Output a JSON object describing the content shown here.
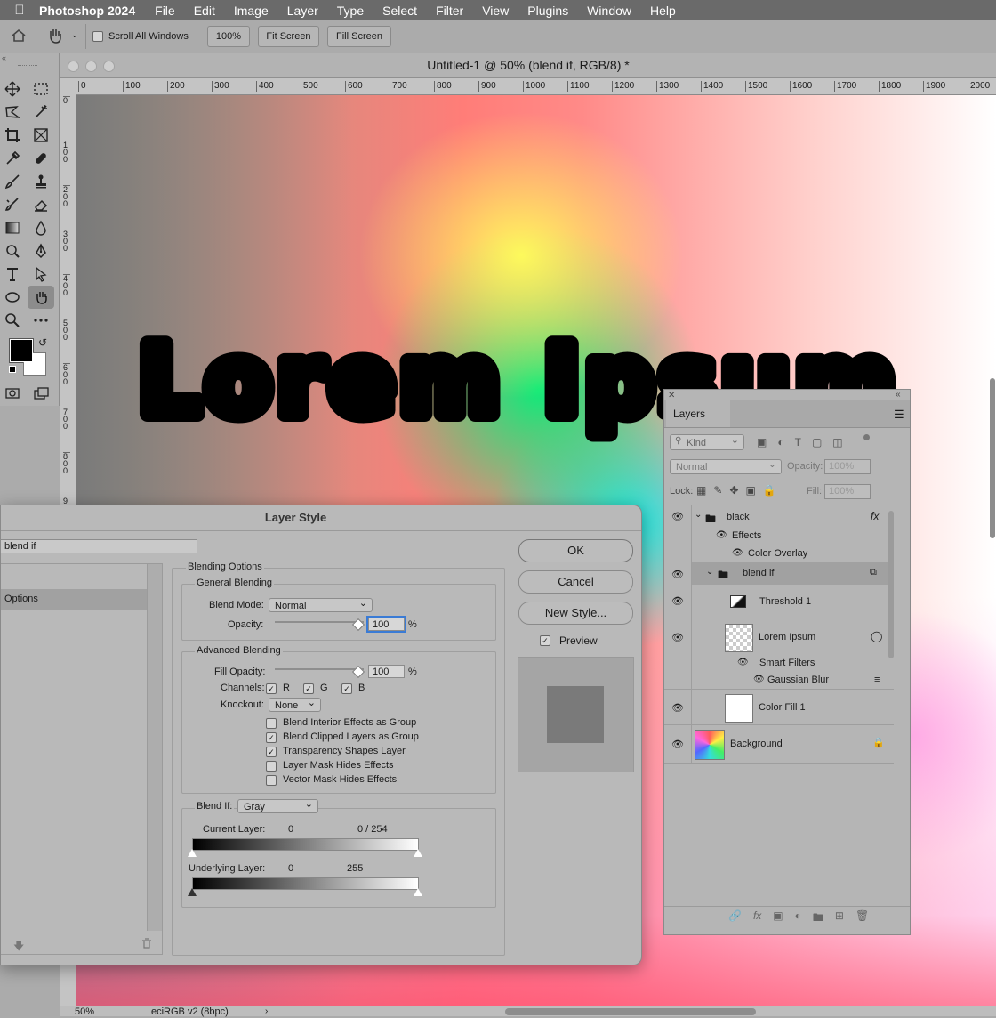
{
  "menubar": {
    "app": "Photoshop 2024",
    "items": [
      "File",
      "Edit",
      "Image",
      "Layer",
      "Type",
      "Select",
      "Filter",
      "View",
      "Plugins",
      "Window",
      "Help"
    ]
  },
  "optionsbar": {
    "scroll_all": "Scroll All Windows",
    "zoom_btn": "100%",
    "fit_btn": "Fit Screen",
    "fill_btn": "Fill Screen"
  },
  "document": {
    "title": "Untitled-1 @ 50% (blend if, RGB/8) *",
    "canvas_text": "Lorem Ipsum",
    "ruler_h": [
      "0",
      "100",
      "200",
      "300",
      "400",
      "500",
      "600",
      "700",
      "800",
      "900",
      "1000",
      "1100",
      "1200",
      "1300",
      "1400",
      "1500",
      "1600",
      "1700",
      "1800",
      "1900",
      "2000"
    ],
    "ruler_v": [
      "0",
      "100",
      "200",
      "300",
      "400",
      "500",
      "600",
      "700",
      "800",
      "900"
    ]
  },
  "statusbar": {
    "zoom": "50%",
    "profile": "eciRGB v2 (8bpc)"
  },
  "dialog": {
    "title": "Layer Style",
    "style_name": "blend if",
    "left_item": "Options",
    "blending_options": "Blending Options",
    "general_blending": "General Blending",
    "blend_mode_label": "Blend Mode:",
    "blend_mode_value": "Normal",
    "opacity_label": "Opacity:",
    "opacity_value": "100",
    "percent": "%",
    "advanced_blending": "Advanced Blending",
    "fill_opacity_label": "Fill Opacity:",
    "fill_opacity_value": "100",
    "channels_label": "Channels:",
    "ch_r": "R",
    "ch_g": "G",
    "ch_b": "B",
    "knockout_label": "Knockout:",
    "knockout_value": "None",
    "options": [
      "Blend Interior Effects as Group",
      "Blend Clipped Layers as Group",
      "Transparency Shapes Layer",
      "Layer Mask Hides Effects",
      "Vector Mask Hides Effects"
    ],
    "options_checked": [
      false,
      true,
      true,
      false,
      false
    ],
    "blend_if_label": "Blend If:",
    "blend_if_value": "Gray",
    "current_layer_label": "Current Layer:",
    "current_layer_low": "0",
    "current_layer_high": "0  /  254",
    "underlying_layer_label": "Underlying Layer:",
    "underlying_low": "0",
    "underlying_high": "255",
    "ok": "OK",
    "cancel": "Cancel",
    "new_style": "New Style...",
    "preview": "Preview"
  },
  "layers": {
    "title": "Layers",
    "kind": "Kind",
    "mode": "Normal",
    "opacity_label": "Opacity:",
    "opacity_value": "100%",
    "lock_label": "Lock:",
    "fill_label": "Fill:",
    "fill_value": "100%",
    "rows": {
      "black": "black",
      "effects": "Effects",
      "color_overlay": "Color Overlay",
      "blend_if": "blend if",
      "threshold": "Threshold 1",
      "lorem": "Lorem Ipsum",
      "smart_filters": "Smart Filters",
      "gaussian": "Gaussian Blur",
      "color_fill": "Color Fill 1",
      "background": "Background"
    },
    "fx": "fx"
  }
}
